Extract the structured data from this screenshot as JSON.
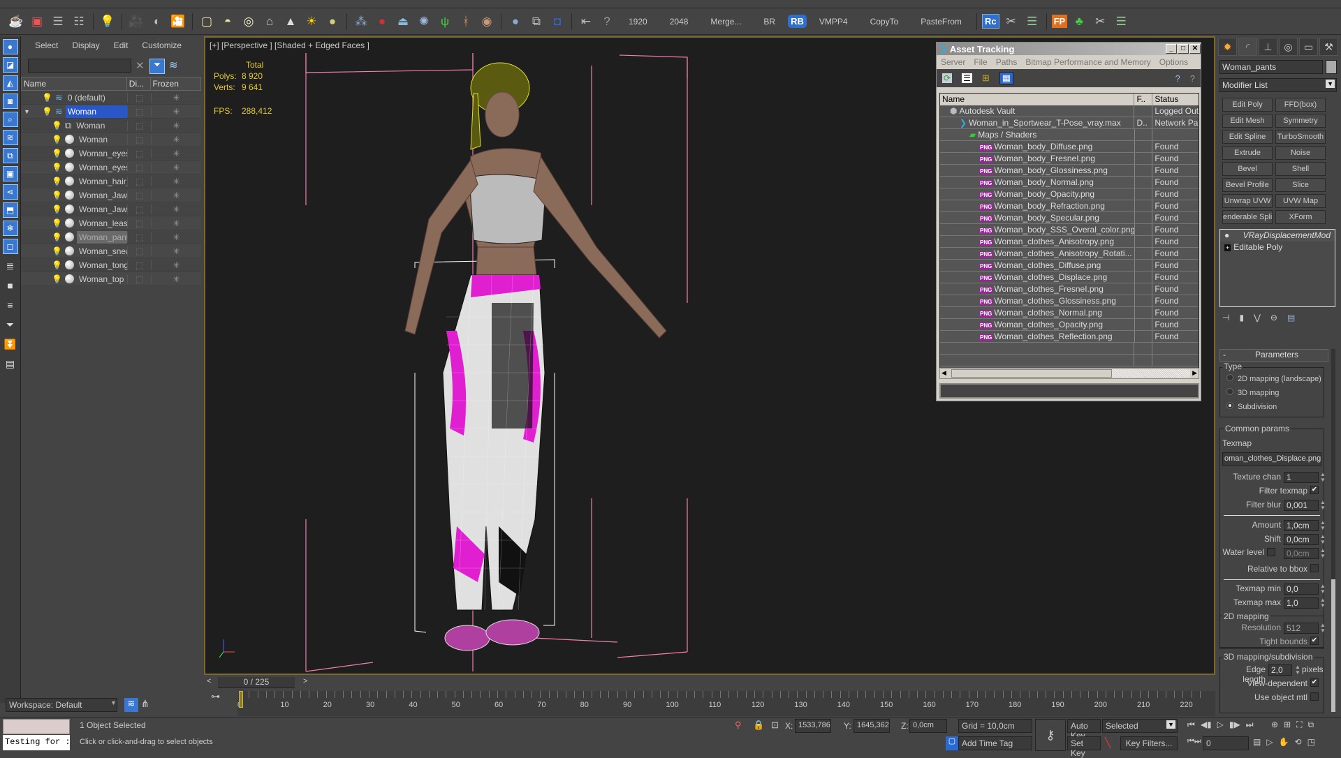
{
  "toolbar": {
    "numbers": [
      "1920",
      "2048"
    ],
    "scripts": [
      "Merge...",
      "BR",
      "VMPP4",
      "CopyTo",
      "PasteFrom"
    ],
    "rb_label": "RB",
    "rc_label": "Rc",
    "fp_label": "FP"
  },
  "scene_explorer": {
    "menu": [
      "Select",
      "Display",
      "Edit",
      "Customize"
    ],
    "search_value": "",
    "columns": {
      "name": "Name",
      "display": "Di...",
      "frozen": "Frozen"
    },
    "items": [
      {
        "name": "0 (default)",
        "type": "layer",
        "selected": false,
        "highlighted": false
      },
      {
        "name": "Woman",
        "type": "layer",
        "selected": true,
        "highlighted": false
      },
      {
        "name": "Woman",
        "type": "group",
        "selected": false,
        "highlighted": false
      },
      {
        "name": "Woman",
        "type": "object",
        "selected": false,
        "highlighted": false
      },
      {
        "name": "Woman_eyes",
        "type": "object",
        "selected": false,
        "highlighted": false
      },
      {
        "name": "Woman_eyes...",
        "type": "object",
        "selected": false,
        "highlighted": false
      },
      {
        "name": "Woman_hair_tail",
        "type": "object",
        "selected": false,
        "highlighted": false
      },
      {
        "name": "Woman_Jaw_...",
        "type": "object",
        "selected": false,
        "highlighted": false
      },
      {
        "name": "Woman_Jaw_...",
        "type": "object",
        "selected": false,
        "highlighted": false
      },
      {
        "name": "Woman_leash",
        "type": "object",
        "selected": false,
        "highlighted": false
      },
      {
        "name": "Woman_pants",
        "type": "object",
        "selected": false,
        "highlighted": true
      },
      {
        "name": "Woman_snea...",
        "type": "object",
        "selected": false,
        "highlighted": false
      },
      {
        "name": "Woman_tongue",
        "type": "object",
        "selected": false,
        "highlighted": false
      },
      {
        "name": "Woman_top",
        "type": "object",
        "selected": false,
        "highlighted": false
      }
    ],
    "workspace": "Workspace: Default"
  },
  "viewport": {
    "label": "[+] [Perspective ] [Shaded + Edged Faces ]",
    "stats": {
      "header": "Total",
      "polys_label": "Polys:",
      "polys": "8 920",
      "verts_label": "Verts:",
      "verts": "9 641",
      "fps_label": "FPS:",
      "fps": "288,412"
    }
  },
  "asset_tracking": {
    "title": "Asset Tracking",
    "menu": [
      "Server",
      "File",
      "Paths",
      "Bitmap Performance and Memory",
      "Options"
    ],
    "columns": [
      "Name",
      "F..",
      "Status"
    ],
    "rows": [
      {
        "name": "Autodesk Vault",
        "f": "",
        "status": "Logged Out",
        "indent": 1,
        "icon": "vault"
      },
      {
        "name": "Woman_in_Sportwear_T-Pose_vray.max",
        "f": "D..",
        "status": "Network Path",
        "indent": 2,
        "icon": "max"
      },
      {
        "name": "Maps / Shaders",
        "f": "",
        "status": "",
        "indent": 3,
        "icon": "maps"
      },
      {
        "name": "Woman_body_Diffuse.png",
        "f": "",
        "status": "Found",
        "indent": 4,
        "icon": "png"
      },
      {
        "name": "Woman_body_FresneI.png",
        "f": "",
        "status": "Found",
        "indent": 4,
        "icon": "png"
      },
      {
        "name": "Woman_body_Glossiness.png",
        "f": "",
        "status": "Found",
        "indent": 4,
        "icon": "png"
      },
      {
        "name": "Woman_body_Normal.png",
        "f": "",
        "status": "Found",
        "indent": 4,
        "icon": "png"
      },
      {
        "name": "Woman_body_Opacity.png",
        "f": "",
        "status": "Found",
        "indent": 4,
        "icon": "png"
      },
      {
        "name": "Woman_body_Refraction.png",
        "f": "",
        "status": "Found",
        "indent": 4,
        "icon": "png"
      },
      {
        "name": "Woman_body_Specular.png",
        "f": "",
        "status": "Found",
        "indent": 4,
        "icon": "png"
      },
      {
        "name": "Woman_body_SSS_Overal_color.png",
        "f": "",
        "status": "Found",
        "indent": 4,
        "icon": "png"
      },
      {
        "name": "Woman_clothes_Anisotropy.png",
        "f": "",
        "status": "Found",
        "indent": 4,
        "icon": "png"
      },
      {
        "name": "Woman_clothes_Anisotropy_Rotati...",
        "f": "",
        "status": "Found",
        "indent": 4,
        "icon": "png"
      },
      {
        "name": "Woman_clothes_Diffuse.png",
        "f": "",
        "status": "Found",
        "indent": 4,
        "icon": "png"
      },
      {
        "name": "Woman_clothes_Displace.png",
        "f": "",
        "status": "Found",
        "indent": 4,
        "icon": "png"
      },
      {
        "name": "Woman_clothes_FresneI.png",
        "f": "",
        "status": "Found",
        "indent": 4,
        "icon": "png"
      },
      {
        "name": "Woman_clothes_Glossiness.png",
        "f": "",
        "status": "Found",
        "indent": 4,
        "icon": "png"
      },
      {
        "name": "Woman_clothes_Normal.png",
        "f": "",
        "status": "Found",
        "indent": 4,
        "icon": "png"
      },
      {
        "name": "Woman_clothes_Opacity.png",
        "f": "",
        "status": "Found",
        "indent": 4,
        "icon": "png"
      },
      {
        "name": "Woman_clothes_Reflection.png",
        "f": "",
        "status": "Found",
        "indent": 4,
        "icon": "png"
      }
    ]
  },
  "command_panel": {
    "object_name": "Woman_pants",
    "modifier_list": "Modifier List",
    "modifier_buttons": [
      "Edit Poly",
      "FFD(box)",
      "Edit Mesh",
      "Symmetry",
      "Edit Spline",
      "TurboSmooth",
      "Extrude",
      "Noise",
      "Bevel",
      "Shell",
      "Bevel Profile",
      "Slice",
      "Unwrap UVW",
      "UVW Map",
      "enderable Splin",
      "XForm"
    ],
    "stack": [
      "VRayDisplacementMod",
      "Editable Poly"
    ],
    "parameters": {
      "title": "Parameters",
      "type_label": "Type",
      "type_options": [
        "2D mapping (landscape)",
        "3D mapping",
        "Subdivision"
      ],
      "type_selected": "Subdivision",
      "common_label": "Common params",
      "texmap_label": "Texmap",
      "texmap_value": "oman_clothes_Displace.png)",
      "texture_chan_label": "Texture chan",
      "texture_chan": "1",
      "filter_texmap_label": "Filter texmap",
      "filter_texmap": true,
      "filter_blur_label": "Filter blur",
      "filter_blur": "0,001",
      "amount_label": "Amount",
      "amount": "1,0cm",
      "shift_label": "Shift",
      "shift": "0,0cm",
      "water_level_label": "Water level",
      "water_level_enabled": false,
      "water_level": "0,0cm",
      "relative_bbox_label": "Relative to bbox",
      "relative_bbox": false,
      "texmap_min_label": "Texmap min",
      "texmap_min": "0,0",
      "texmap_max_label": "Texmap max",
      "texmap_max": "1,0",
      "mapping2d_label": "2D mapping",
      "resolution_label": "Resolution",
      "resolution": "512",
      "tight_bounds_label": "Tight bounds",
      "tight_bounds": true,
      "mapping3d_label": "3D mapping/subdivision",
      "edge_length_label": "Edge length",
      "edge_length": "2,0",
      "pixels_label": "pixels",
      "view_dependent_label": "View-dependent",
      "view_dependent": true,
      "use_object_mtl_label": "Use object mtl",
      "use_object_mtl": false
    }
  },
  "timeline": {
    "frame_display": "0 / 225",
    "current_frame": 0,
    "total_frames": 225,
    "tick_labels": [
      "0",
      "10",
      "20",
      "30",
      "40",
      "50",
      "60",
      "70",
      "80",
      "90",
      "100",
      "110",
      "120",
      "130",
      "140",
      "150",
      "160",
      "170",
      "180",
      "190",
      "200",
      "210",
      "220"
    ]
  },
  "status_bar": {
    "maxscript_text": "Testing for :",
    "selection": "1 Object Selected",
    "prompt": "Click or click-and-drag to select objects",
    "x_label": "X:",
    "x": "1533,786cı",
    "y_label": "Y:",
    "y": "1645,362cı",
    "z_label": "Z:",
    "z": "0,0cm",
    "grid": "Grid = 10,0cm",
    "add_time_tag": "Add Time Tag",
    "auto_key": "Auto Key",
    "set_key": "Set Key",
    "key_mode": "Selected",
    "key_filters": "Key Filters...",
    "frame": "0"
  }
}
